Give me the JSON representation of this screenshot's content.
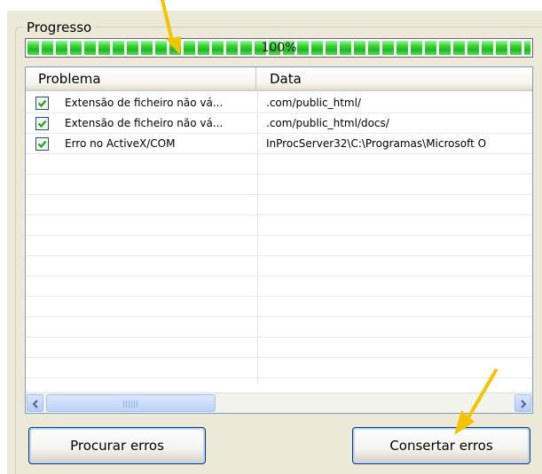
{
  "progress": {
    "group_label": "Progresso",
    "percent_text": "100%",
    "value": 1.0
  },
  "list": {
    "columns": [
      "Problema",
      "Data"
    ],
    "rows": [
      {
        "checked": true,
        "problem": "Extensão de ficheiro não vá...",
        "data": ".com/public_html/"
      },
      {
        "checked": true,
        "problem": "Extensão de ficheiro não vá...",
        "data": ".com/public_html/docs/"
      },
      {
        "checked": true,
        "problem": "Erro no ActiveX/COM",
        "data": "InProcServer32\\C:\\Programas\\Microsoft O"
      }
    ]
  },
  "buttons": {
    "find_label": "Procurar erros",
    "fix_label": "Consertar erros"
  },
  "colors": {
    "progress_green": "#1eb81e",
    "annotation_arrow": "#f5c400"
  }
}
